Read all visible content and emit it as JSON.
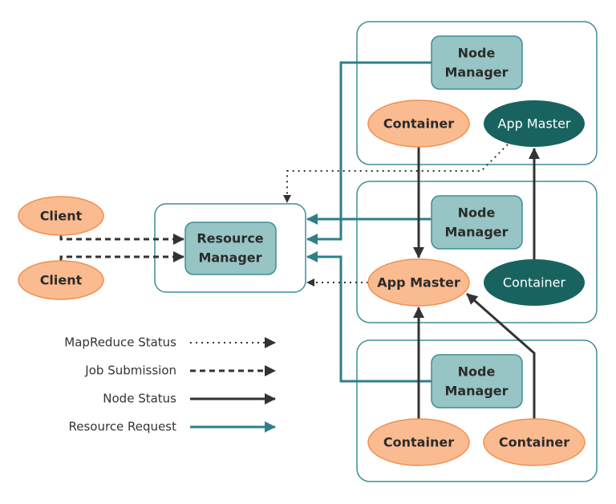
{
  "colors": {
    "container_border": "#3e8e94",
    "manager_fill": "#97c4c4",
    "orange_fill": "#fbbb90",
    "orange_stroke": "#f0904f",
    "dark_teal": "#18635f",
    "status_line": "#333333",
    "request_line": "#2f7f88"
  },
  "clients": [
    "Client",
    "Client"
  ],
  "resource_manager": {
    "line1": "Resource",
    "line2": "Manager"
  },
  "nodes": [
    {
      "manager": {
        "line1": "Node",
        "line2": "Manager"
      },
      "left": "Container",
      "right": "App Master",
      "right_style": "dark"
    },
    {
      "manager": {
        "line1": "Node",
        "line2": "Manager"
      },
      "left": "App Master",
      "right": "Container",
      "right_style": "dark"
    },
    {
      "manager": {
        "line1": "Node",
        "line2": "Manager"
      },
      "left": "Container",
      "right": "Container",
      "right_style": "orange"
    }
  ],
  "legend": [
    {
      "label": "MapReduce Status",
      "style": "dotted"
    },
    {
      "label": "Job Submission",
      "style": "dashed"
    },
    {
      "label": "Node Status",
      "style": "solid-dark"
    },
    {
      "label": "Resource Request",
      "style": "solid-teal"
    }
  ]
}
